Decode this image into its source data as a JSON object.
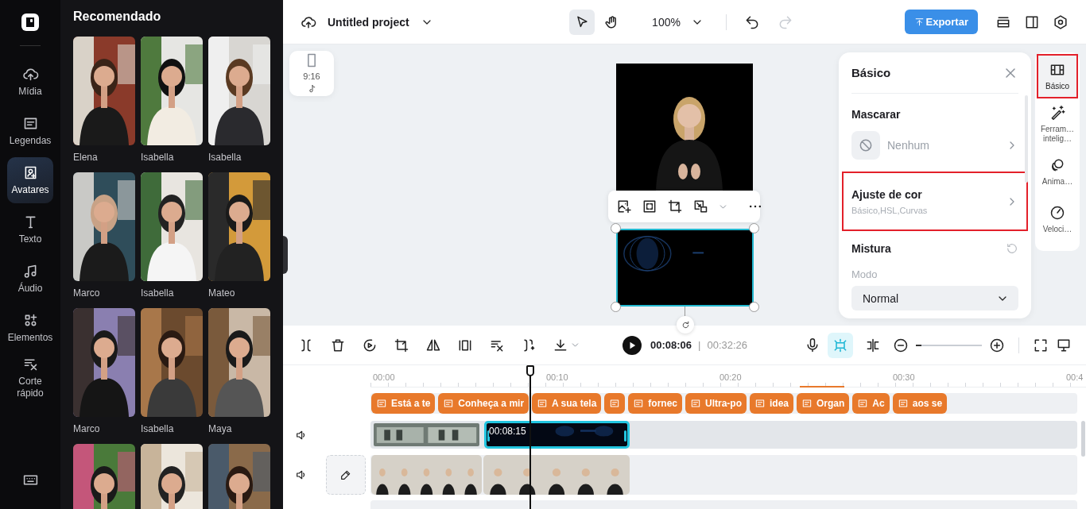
{
  "sidebar": {
    "items": [
      {
        "label": "Mídia",
        "selected": false
      },
      {
        "label": "Legendas",
        "selected": false
      },
      {
        "label": "Avatares",
        "selected": true
      },
      {
        "label": "Texto",
        "selected": false
      },
      {
        "label": "Áudio",
        "selected": false
      },
      {
        "label": "Elementos",
        "selected": false
      },
      {
        "label": "Corte rápido",
        "selected": false
      }
    ]
  },
  "avatar_panel": {
    "title": "Recomendado",
    "avatars": [
      {
        "kind": "picture",
        "name": "Elena"
      },
      {
        "kind": "picture",
        "name": "Isabella"
      },
      {
        "kind": "picture",
        "name": "Isabella"
      },
      {
        "kind": "picture",
        "name": "Marco"
      },
      {
        "kind": "picture",
        "name": "Isabella"
      },
      {
        "kind": "picture",
        "name": "Mateo"
      },
      {
        "kind": "picture",
        "name": "Marco"
      },
      {
        "kind": "picture",
        "name": "Isabella"
      },
      {
        "kind": "picture",
        "name": "Maya"
      },
      {
        "kind": "picture"
      },
      {
        "kind": "picture"
      },
      {
        "kind": "picture"
      }
    ]
  },
  "top_bar": {
    "project_title": "Untitled project",
    "tools": [
      {
        "selected": true
      },
      {
        "selected": false
      }
    ],
    "zoom": "100%",
    "undo": {
      "disabled": false
    },
    "redo": {
      "disabled": true
    },
    "export_label": "Exportar"
  },
  "canvas": {
    "aspect_ratio": "9:16"
  },
  "properties_panel": {
    "title": "Básico",
    "mask": {
      "label": "Mascarar",
      "value": "Nenhum"
    },
    "color_adjust": {
      "label": "Ajuste de cor",
      "detail": "Básico,HSL,Curvas",
      "highlighted": true
    },
    "blend": {
      "label": "Mistura",
      "mode_label": "Modo",
      "mode": "Normal"
    }
  },
  "panel_tabs": [
    {
      "label": "Básico",
      "selected": true,
      "highlighted": true
    },
    {
      "label": "Ferram… intelig…",
      "selected": false,
      "highlighted": false
    },
    {
      "label": "Anima…",
      "selected": false,
      "highlighted": false
    },
    {
      "label": "Veloci…",
      "selected": false,
      "highlighted": false
    }
  ],
  "timeline": {
    "current_time": "00:08:06",
    "separator": "|",
    "total_time": "00:32:26",
    "toggles": [
      {
        "selected": true
      },
      {
        "selected": false
      }
    ],
    "zoom": {
      "level": 0.08
    },
    "ruler": [
      "00:00",
      "00:10",
      "00:20",
      "00:30",
      "00:4"
    ],
    "captions": [
      {
        "kind": "caption",
        "label": "Está a te"
      },
      {
        "kind": "caption",
        "label": "Conheça a mir"
      },
      {
        "kind": "caption",
        "label": "A sua tela"
      },
      {
        "kind": "caption"
      },
      {
        "kind": "caption",
        "label": "fornec"
      },
      {
        "kind": "caption",
        "label": "Ultra-po"
      },
      {
        "kind": "caption",
        "label": "idea"
      },
      {
        "kind": "caption",
        "label": "Organ"
      },
      {
        "kind": "caption",
        "label": "Ac"
      },
      {
        "kind": "caption",
        "label": "aos se"
      }
    ],
    "video_clips": [
      {
        "selected": false
      },
      {
        "selected": true,
        "time": "00:08:15"
      }
    ],
    "avatar_clips": [
      {
        "selected": false
      },
      {
        "selected": false
      }
    ]
  }
}
